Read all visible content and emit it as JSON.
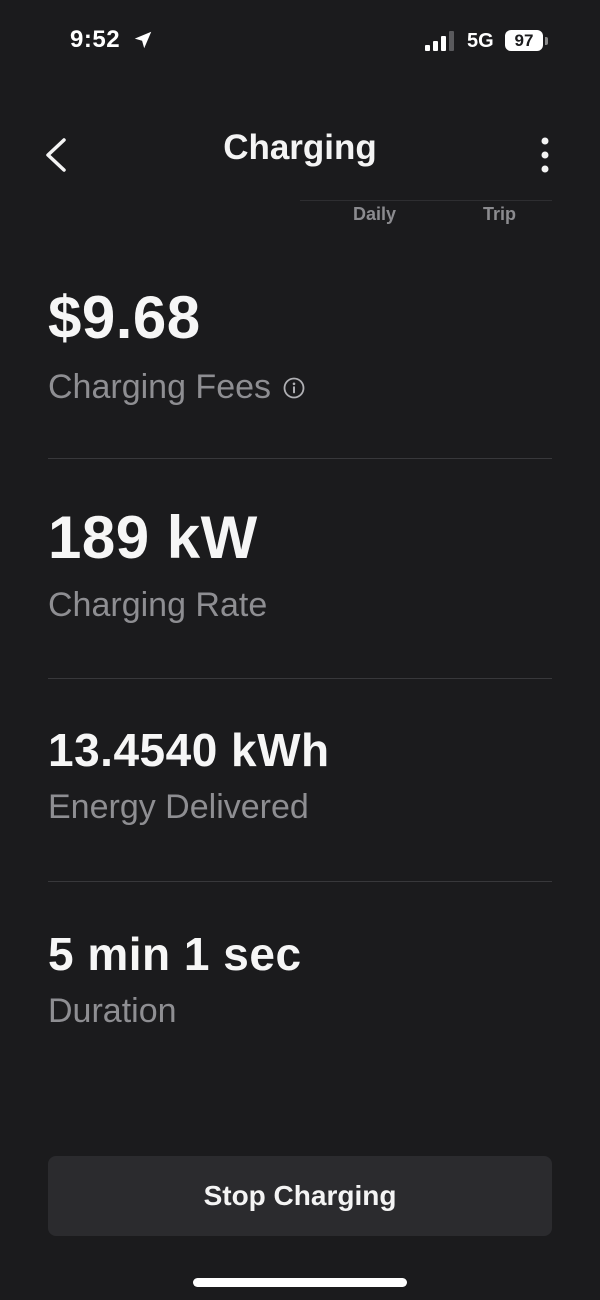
{
  "status_bar": {
    "time": "9:52",
    "network": "5G",
    "battery": "97"
  },
  "header": {
    "title": "Charging"
  },
  "tabs": [
    {
      "label": "Daily"
    },
    {
      "label": "Trip"
    }
  ],
  "metrics": {
    "fees": {
      "value": "$9.68",
      "label": "Charging Fees"
    },
    "rate": {
      "value": "189 kW",
      "label": "Charging Rate"
    },
    "energy": {
      "value": "13.4540 kWh",
      "label": "Energy Delivered"
    },
    "duration": {
      "value": "5 min 1 sec",
      "label": "Duration"
    }
  },
  "actions": {
    "stop_label": "Stop Charging"
  },
  "icons": {
    "back": "chevron-left-icon",
    "more": "more-vertical-icon",
    "info": "info-icon",
    "location": "location-arrow-icon",
    "signal": "cellular-signal-icon",
    "battery": "battery-icon"
  },
  "colors": {
    "background": "#1b1b1d",
    "primary_text": "#f4f4f4",
    "secondary_text": "#8e8e92",
    "button_bg": "#2b2b2e"
  }
}
